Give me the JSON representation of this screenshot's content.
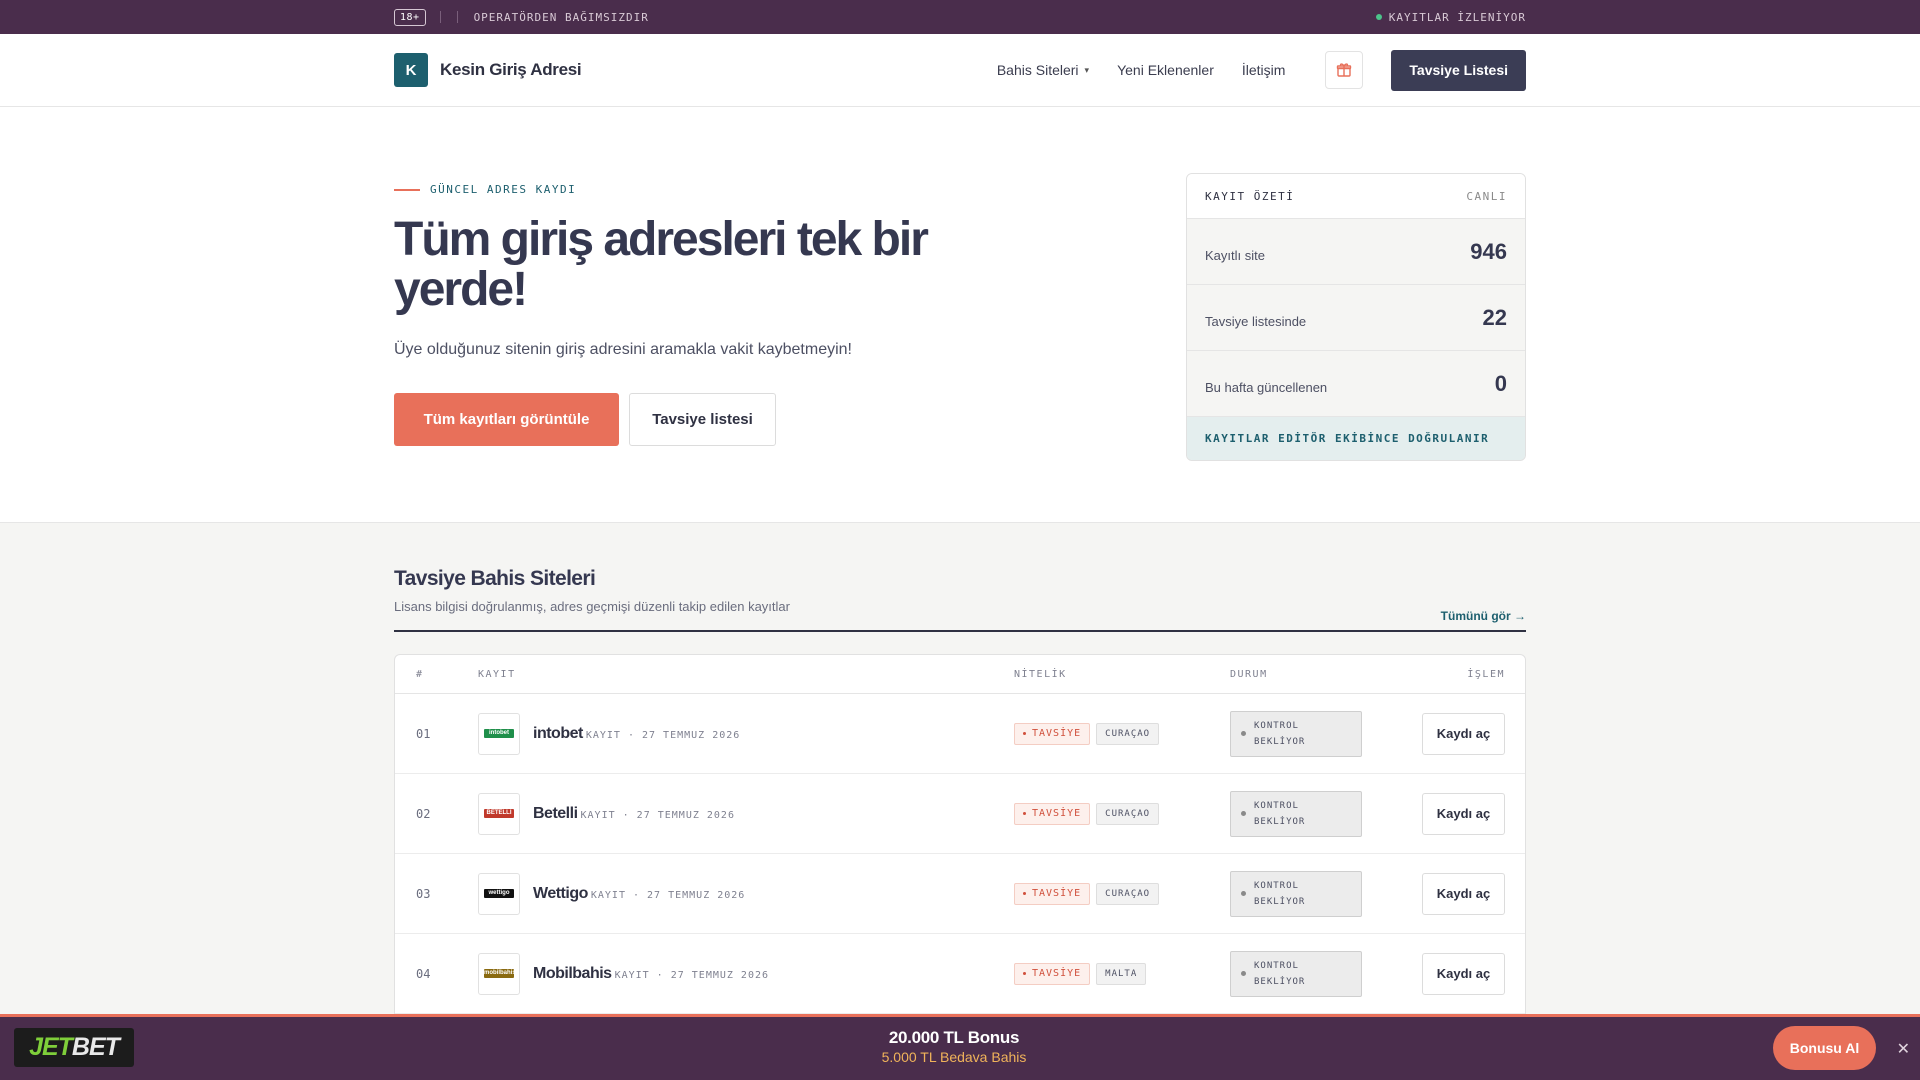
{
  "topbar": {
    "age": "18+",
    "independent": "OPERATÖRDEN BAĞIMSIZDIR",
    "monitor": "KAYITLAR İZLENİYOR"
  },
  "header": {
    "logo_letter": "K",
    "logo_text": "Kesin Giriş Adresi",
    "nav": [
      "Bahis Siteleri",
      "Yeni Eklenenler",
      "İletişim"
    ],
    "cta": "Tavsiye Listesi"
  },
  "hero": {
    "eyebrow": "GÜNCEL ADRES KAYDI",
    "title": "Tüm giriş adresleri tek bir yerde!",
    "subtitle": "Üye olduğunuz sitenin giriş adresini aramakla vakit kaybetmeyin!",
    "primary_button": "Tüm kayıtları görüntüle",
    "secondary_button": "Tavsiye listesi"
  },
  "summary": {
    "title": "KAYIT ÖZETİ",
    "live": "CANLI",
    "rows": [
      {
        "label": "Kayıtlı site",
        "value": "946"
      },
      {
        "label": "Tavsiye listesinde",
        "value": "22"
      },
      {
        "label": "Bu hafta güncellenen",
        "value": "0"
      }
    ],
    "footer": "KAYITLAR EDİTÖR EKİBİNCE DOĞRULANIR"
  },
  "section": {
    "title": "Tavsiye Bahis Siteleri",
    "subtitle": "Lisans bilgisi doğrulanmış, adres geçmişi düzenli takip edilen kayıtlar",
    "see_all": "Tümünü gör →"
  },
  "table": {
    "headers": {
      "num": "#",
      "kayit": "KAYIT",
      "nitelik": "NİTELİK",
      "durum": "DURUM",
      "islem": "İŞLEM"
    },
    "rows": [
      {
        "num": "01",
        "name": "intobet",
        "logo_text": "intobet",
        "logo_color": "#1f8f4a",
        "meta": "KAYIT · 27 TEMMUZ 2026",
        "tag": "TAVSİYE",
        "license": "CURAÇAO",
        "status_1": "KONTROL",
        "status_2": "BEKLİYOR",
        "action": "Kaydı aç"
      },
      {
        "num": "02",
        "name": "Betelli",
        "logo_text": "BETELLI",
        "logo_color": "#c0392b",
        "meta": "KAYIT · 27 TEMMUZ 2026",
        "tag": "TAVSİYE",
        "license": "CURAÇAO",
        "status_1": "KONTROL",
        "status_2": "BEKLİYOR",
        "action": "Kaydı aç"
      },
      {
        "num": "03",
        "name": "Wettigo",
        "logo_text": "wettigo",
        "logo_color": "#111111",
        "meta": "KAYIT · 27 TEMMUZ 2026",
        "tag": "TAVSİYE",
        "license": "CURAÇAO",
        "status_1": "KONTROL",
        "status_2": "BEKLİYOR",
        "action": "Kaydı aç"
      },
      {
        "num": "04",
        "name": "Mobilbahis",
        "logo_text": "mobilbahis",
        "logo_color": "#8a6a10",
        "meta": "KAYIT · 27 TEMMUZ 2026",
        "tag": "TAVSİYE",
        "license": "MALTA",
        "status_1": "KONTROL",
        "status_2": "BEKLİYOR",
        "action": "Kaydı aç"
      }
    ]
  },
  "banner": {
    "logo_part1": "JET",
    "logo_part2": "BET",
    "title": "20.000 TL Bonus",
    "subtitle": "5.000 TL Bedava Bahis",
    "button": "Bonusu Al",
    "close": "✕"
  },
  "colors": {
    "brand_purple": "#4a2d4c",
    "accent_coral": "#e8705a",
    "teal": "#1d5f6e",
    "dark": "#3b3d55"
  }
}
